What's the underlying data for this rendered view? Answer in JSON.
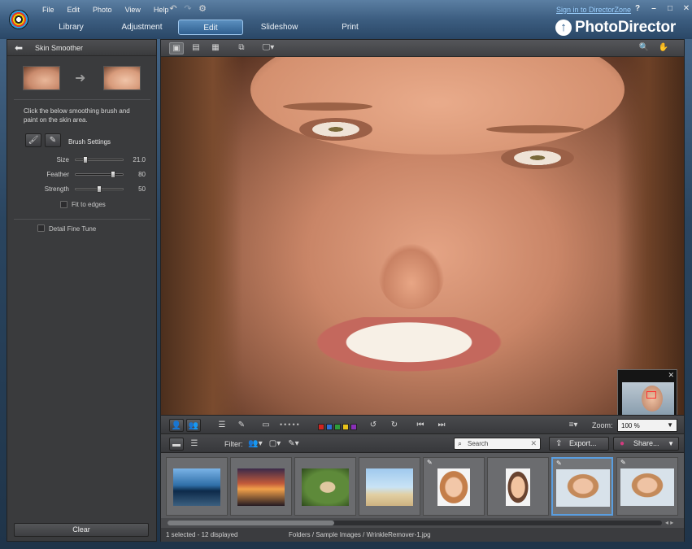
{
  "menu": {
    "items": [
      "File",
      "Edit",
      "Photo",
      "View",
      "Help"
    ]
  },
  "toolbar_icons": [
    "undo-icon",
    "redo-icon",
    "gear-icon"
  ],
  "header": {
    "signin_link": "Sign in to DirectorZone",
    "brand": "PhotoDirector"
  },
  "window_controls": [
    "?",
    "–",
    "□",
    "✕"
  ],
  "mode_tabs": [
    {
      "label": "Library",
      "active": false
    },
    {
      "label": "Adjustment",
      "active": false
    },
    {
      "label": "Edit",
      "active": true
    },
    {
      "label": "Slideshow",
      "active": false
    },
    {
      "label": "Print",
      "active": false
    }
  ],
  "left_panel": {
    "title": "Skin Smoother",
    "instructions": "Click the below smoothing brush and paint on the skin area.",
    "brush_settings_label": "Brush Settings",
    "sliders": [
      {
        "label": "Size",
        "value": "21.0",
        "level": 0.21
      },
      {
        "label": "Feather",
        "value": "80",
        "level": 0.8
      },
      {
        "label": "Strength",
        "value": "50",
        "level": 0.5
      }
    ],
    "fit_to_edges": {
      "label": "Fit to edges",
      "checked": false
    },
    "detail_fine_tune": {
      "label": "Detail Fine Tune",
      "checked": false
    },
    "clear_label": "Clear"
  },
  "edit_toolbar": {
    "colors": [
      "#d0231f",
      "#2f6fd6",
      "#2e9c3a",
      "#e8c21a",
      "#8a2fb8"
    ],
    "zoom_label": "Zoom:",
    "zoom_value": "100 %"
  },
  "browser_bar": {
    "filter_label": "Filter:",
    "search_placeholder": "Search",
    "export_label": "Export...",
    "share_label": "Share..."
  },
  "filmstrip": {
    "items": [
      {
        "name": "lake-scene",
        "edited": false,
        "selected": false
      },
      {
        "name": "sunset-scene",
        "edited": false,
        "selected": false
      },
      {
        "name": "cat-in-grass",
        "edited": false,
        "selected": false
      },
      {
        "name": "beach-couple",
        "edited": false,
        "selected": false
      },
      {
        "name": "smiling-woman",
        "edited": true,
        "selected": false
      },
      {
        "name": "laughing-child",
        "edited": false,
        "selected": false
      },
      {
        "name": "wrinkle-remover-1",
        "edited": true,
        "selected": true
      },
      {
        "name": "wrinkle-remover-2",
        "edited": true,
        "selected": false
      }
    ]
  },
  "status": {
    "selection": "1 selected - 12 displayed",
    "path": "Folders / Sample Images / WrinkleRemover-1.jpg"
  }
}
